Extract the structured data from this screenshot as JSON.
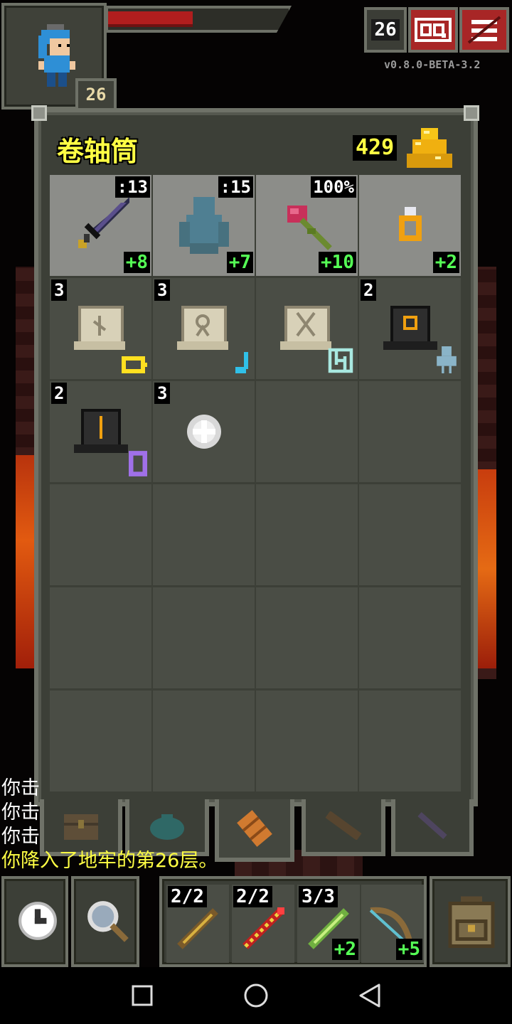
{
  "hero": {
    "level": "26",
    "hp_fraction": 0.47
  },
  "status": {
    "depth": "26",
    "version": "v0.8.0-BETA-3.2",
    "journal_icon": "journal-icon",
    "menu_icon": "menu-icon"
  },
  "bag": {
    "title": "卷轴筒",
    "gold": "429",
    "slots": [
      {
        "icon": "sword-icon",
        "top_right": ":13",
        "bottom_right": "+8",
        "equipped": true
      },
      {
        "icon": "cloth-armor-icon",
        "top_right": ":15",
        "bottom_right": "+7",
        "equipped": true
      },
      {
        "icon": "rose-icon",
        "top_right": "100%",
        "bottom_right": "+10",
        "equipped": true
      },
      {
        "icon": "ring-icon",
        "bottom_right": "+2",
        "equipped": true
      },
      {
        "icon": "scroll-icon",
        "top_left": "3",
        "badge": "battery-icon"
      },
      {
        "icon": "scroll-icon",
        "top_left": "3",
        "badge": "music-note-icon"
      },
      {
        "icon": "scroll-icon",
        "badge": "maze-icon"
      },
      {
        "icon": "potion-box-icon",
        "top_left": "2",
        "badge": "ghost-icon"
      },
      {
        "icon": "potion-box-icon",
        "top_left": "2",
        "badge": "gem-icon"
      },
      {
        "icon": "white-orb-icon",
        "top_left": "3"
      }
    ],
    "tabs": [
      "chest-icon",
      "seed-pouch-icon",
      "scroll-holder-icon",
      "wand-holster-icon",
      "wand-icon"
    ]
  },
  "log": [
    {
      "text": "你击",
      "color": "white"
    },
    {
      "text": "你击",
      "color": "white"
    },
    {
      "text": "你击",
      "color": "white"
    },
    {
      "text": "你降入了地牢的第26层。",
      "color": "yellow"
    }
  ],
  "toolbar": {
    "wait_icon": "clock-icon",
    "search_icon": "magnifier-icon",
    "quickslots": [
      {
        "icon": "wand-icon",
        "top_left": "2/2"
      },
      {
        "icon": "wand-icon",
        "top_left": "2/2"
      },
      {
        "icon": "wand-icon",
        "top_left": "3/3",
        "bottom_right": "+2"
      },
      {
        "icon": "bow-icon",
        "bottom_right": "+5"
      }
    ],
    "backpack_icon": "backpack-icon"
  },
  "navbar": [
    "back-square-icon",
    "home-circle-icon",
    "back-triangle-icon"
  ]
}
